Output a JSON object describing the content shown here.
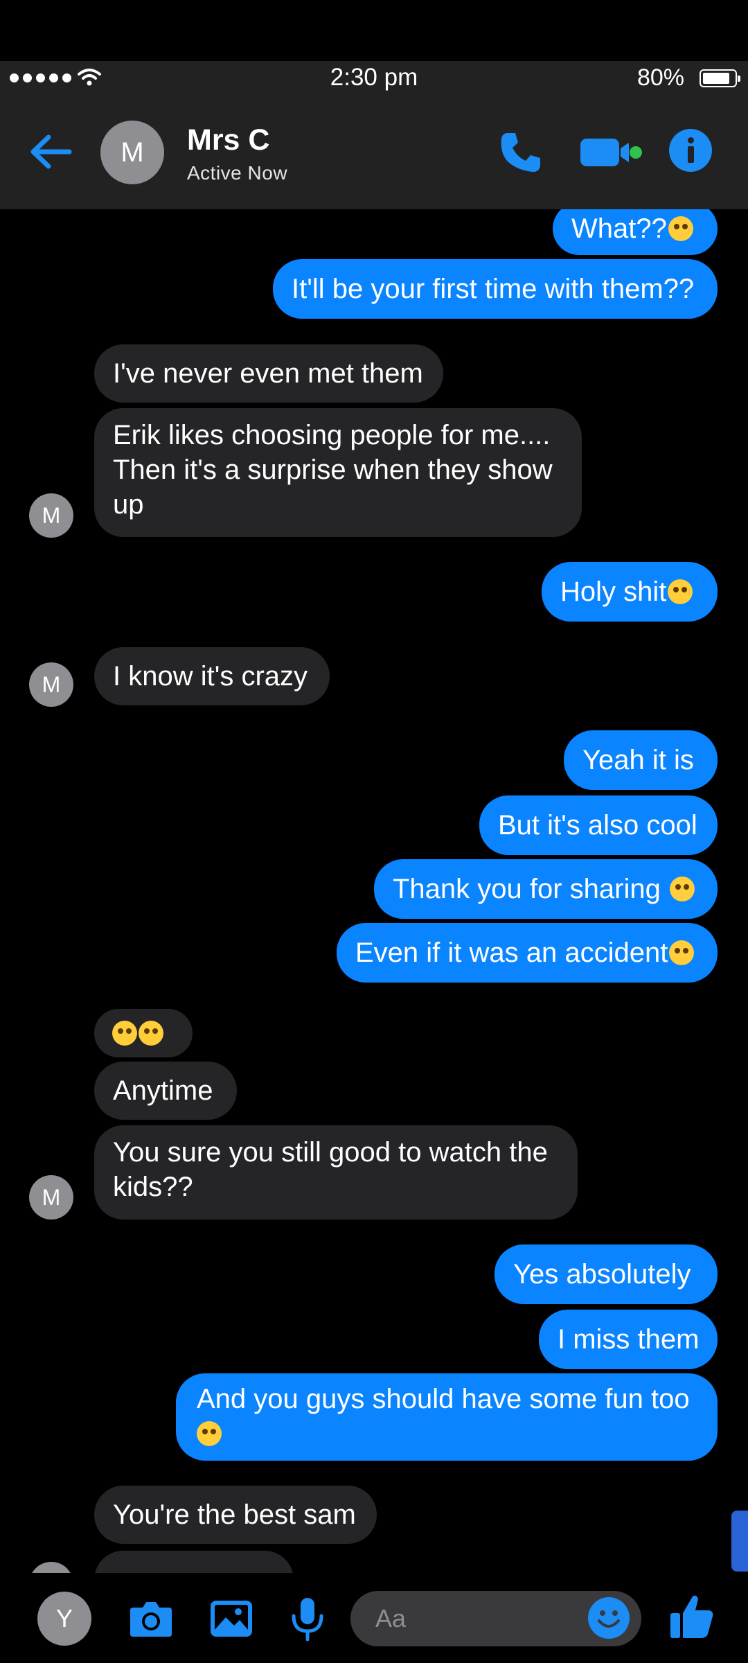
{
  "status_bar": {
    "time": "2:30 pm",
    "battery": "80%"
  },
  "header": {
    "contact_initial": "M",
    "contact_name": "Mrs C",
    "contact_status": "Active Now"
  },
  "messages": [
    {
      "from": "me",
      "text": "What??"
    },
    {
      "from": "me",
      "text": "It'll be your first time with them??"
    },
    {
      "from": "them",
      "text": "I've never even met them"
    },
    {
      "from": "them",
      "text": "Erik likes choosing people for me.... Then it's a surprise when they show up"
    },
    {
      "from": "me",
      "text": "Holy shit"
    },
    {
      "from": "them",
      "text": "I know it's crazy"
    },
    {
      "from": "me",
      "text": "Yeah it is"
    },
    {
      "from": "me",
      "text": "But it's also cool"
    },
    {
      "from": "me",
      "text": "Thank you for sharing "
    },
    {
      "from": "me",
      "text": "Even if it was an accident"
    },
    {
      "from": "them",
      "text": ""
    },
    {
      "from": "them",
      "text": "Anytime"
    },
    {
      "from": "them",
      "text": "You sure you still good to watch the kids??"
    },
    {
      "from": "me",
      "text": "Yes absolutely"
    },
    {
      "from": "me",
      "text": "I miss them"
    },
    {
      "from": "me",
      "text": "And you guys should have some fun too"
    },
    {
      "from": "them",
      "text": "You're the best sam"
    }
  ],
  "emoji_icons": [
    "flushed-face",
    "flushed-face",
    "face-with-hand-over-mouth",
    "rolling-on-floor-laughing",
    "rolling-on-floor-laughing",
    "rolling-on-floor-laughing",
    "face-with-hand-over-mouth"
  ],
  "message_avatar_initial": "M",
  "composer": {
    "user_initial": "Y",
    "placeholder": "Aa"
  },
  "colors": {
    "my_bubble": "#0a84ff",
    "their_bubble": "#252528",
    "header_bg": "#222222",
    "accent": "#1b8df5",
    "online": "#31c24d"
  }
}
